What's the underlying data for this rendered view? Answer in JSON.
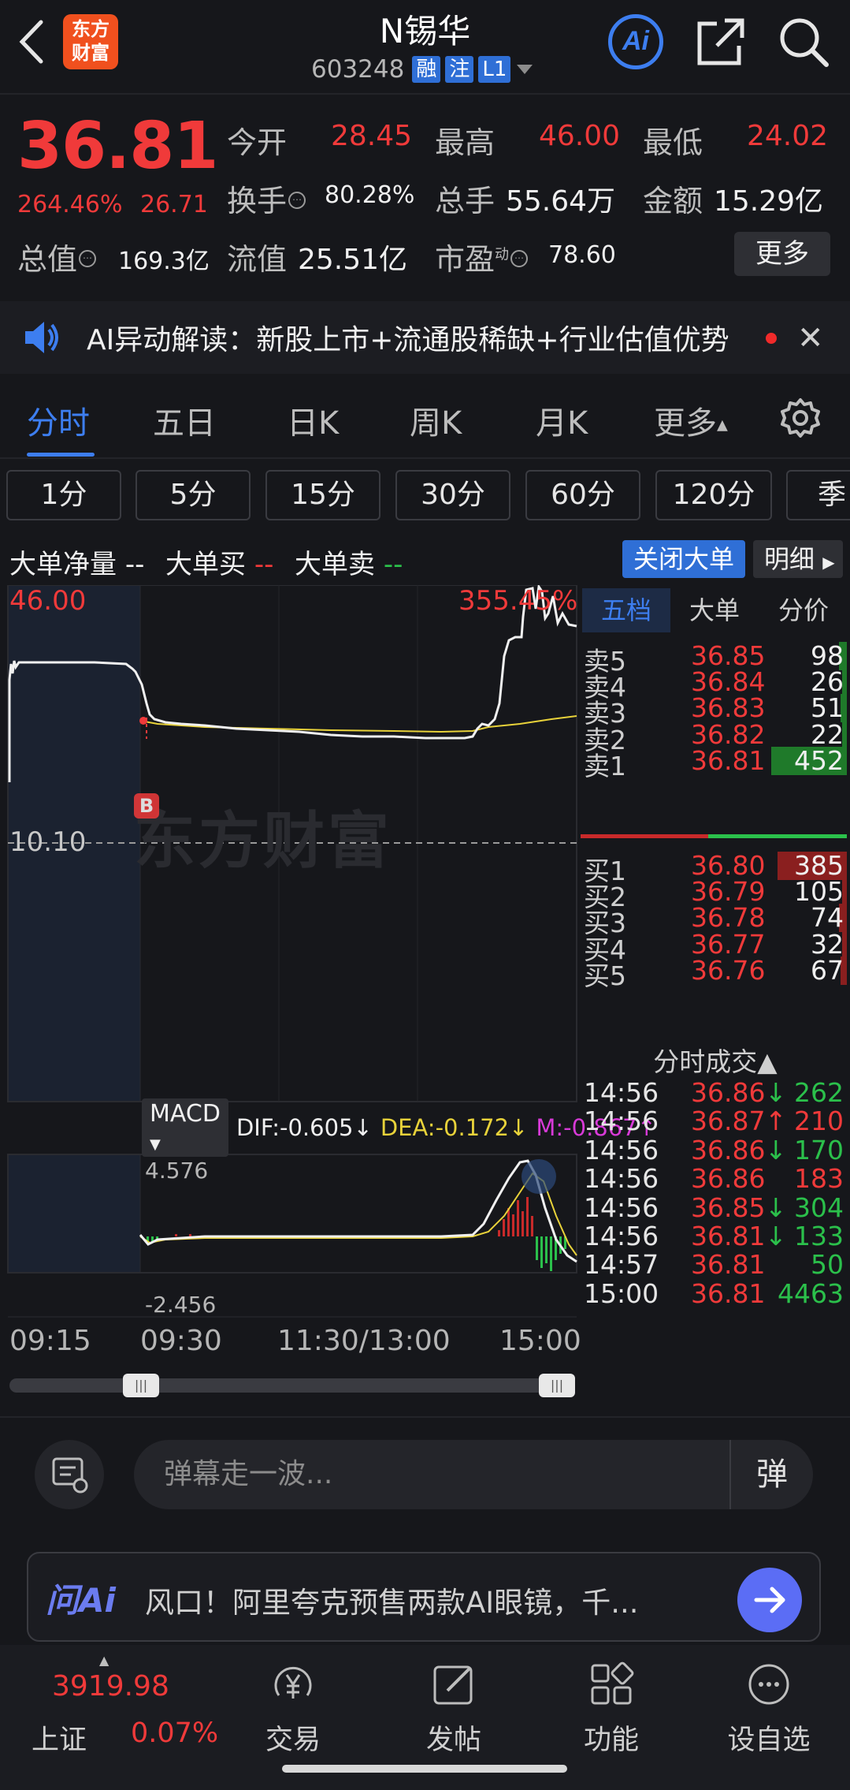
{
  "header": {
    "logo_line1": "东方",
    "logo_line2": "财富",
    "stock_name": "N锡华",
    "stock_code": "603248",
    "tags": [
      "融",
      "注",
      "L1"
    ],
    "ai_label": "Ai",
    "icons": [
      "back-icon",
      "ai-icon",
      "share-icon",
      "search-icon",
      "dropdown-icon"
    ]
  },
  "quote": {
    "price": "36.81",
    "change_pct": "264.46%",
    "change_amt": "26.71",
    "open_label": "今开",
    "open": "28.45",
    "high_label": "最高",
    "high": "46.00",
    "low_label": "最低",
    "low": "24.02",
    "turnover_label": "换手",
    "turnover": "80.28%",
    "volume_label": "总手",
    "volume": "55.64万",
    "amount_label": "金额",
    "amount": "15.29亿",
    "mktcap_label": "总值",
    "mktcap": "169.3亿",
    "float_label": "流值",
    "float_cap": "25.51亿",
    "pe_label": "市盈",
    "pe_sup": "动",
    "pe": "78.60",
    "more_label": "更多",
    "colors": {
      "up": "#f03a3a",
      "down": "#2bc04b",
      "accent": "#3d7ef0"
    }
  },
  "ai_bar": {
    "text": "AI异动解读：新股上市+流通股稀缺+行业估值优势"
  },
  "period_tabs": {
    "items": [
      "分时",
      "五日",
      "日K",
      "周K",
      "月K",
      "更多"
    ],
    "active": "分时"
  },
  "minute_tabs": [
    "1分",
    "5分",
    "15分",
    "30分",
    "60分",
    "120分",
    "季"
  ],
  "big_order": {
    "net_label": "大单净量",
    "net_value": "--",
    "buy_label": "大单买",
    "buy_value": "--",
    "sell_label": "大单卖",
    "sell_value": "--",
    "close_label": "关闭大单",
    "detail_label": "明细"
  },
  "chart": {
    "price_top": "46.00",
    "pct_top": "355.45%",
    "prev_close": "10.10",
    "watermark": "东方财富",
    "b_marker": "B",
    "macd_select": "MACD",
    "dif": "DIF:-0.605↓",
    "dea": "DEA:-0.172↓",
    "m": "M:-0.867↑",
    "macd_high": "4.576",
    "macd_low": "-2.456",
    "time_labels": [
      "09:15",
      "09:30",
      "11:30/13:00",
      "15:00"
    ]
  },
  "orderbook": {
    "tabs": [
      "五档",
      "大单",
      "分价"
    ],
    "active_tab": "五档",
    "asks": [
      {
        "label": "卖5",
        "price": "36.85",
        "vol": "98",
        "bar": 0.06
      },
      {
        "label": "卖4",
        "price": "36.84",
        "vol": "26",
        "bar": 0.04
      },
      {
        "label": "卖3",
        "price": "36.83",
        "vol": "51",
        "bar": 0.05
      },
      {
        "label": "卖2",
        "price": "36.82",
        "vol": "22",
        "bar": 0.04
      },
      {
        "label": "卖1",
        "price": "36.81",
        "vol": "452",
        "bar": 0.6
      }
    ],
    "bids": [
      {
        "label": "买1",
        "price": "36.80",
        "vol": "385",
        "bar": 0.55
      },
      {
        "label": "买2",
        "price": "36.79",
        "vol": "105",
        "bar": 0.04
      },
      {
        "label": "买3",
        "price": "36.78",
        "vol": "74",
        "bar": 0.06
      },
      {
        "label": "买4",
        "price": "36.77",
        "vol": "32",
        "bar": 0.04
      },
      {
        "label": "买5",
        "price": "36.76",
        "vol": "67",
        "bar": 0.05
      }
    ],
    "trades_title": "分时成交▲",
    "trades": [
      {
        "time": "14:56",
        "price": "36.86",
        "arrow": "↓",
        "vol": "262",
        "dir": "down"
      },
      {
        "time": "14:56",
        "price": "36.87",
        "arrow": "↑",
        "vol": "210",
        "dir": "up"
      },
      {
        "time": "14:56",
        "price": "36.86",
        "arrow": "↓",
        "vol": "170",
        "dir": "down"
      },
      {
        "time": "14:56",
        "price": "36.86",
        "arrow": "",
        "vol": "183",
        "dir": "up"
      },
      {
        "time": "14:56",
        "price": "36.85",
        "arrow": "↓",
        "vol": "304",
        "dir": "down"
      },
      {
        "time": "14:56",
        "price": "36.81",
        "arrow": "↓",
        "vol": "133",
        "dir": "down"
      },
      {
        "time": "14:57",
        "price": "36.81",
        "arrow": "",
        "vol": "50",
        "dir": "down"
      },
      {
        "time": "15:00",
        "price": "36.81",
        "arrow": "",
        "vol": "4463",
        "dir": "down"
      }
    ]
  },
  "comment": {
    "placeholder": "弹幕走一波...",
    "danmu_label": "弹"
  },
  "ask_ai": {
    "logo": "问Ai",
    "text": "风口！阿里夸克预售两款AI眼镜，千..."
  },
  "bottom_nav": {
    "index_value": "3919.98",
    "index_name": "上证",
    "index_change": "0.07%",
    "items": [
      {
        "label": "交易",
        "icon": "yuan-icon"
      },
      {
        "label": "发帖",
        "icon": "edit-icon"
      },
      {
        "label": "功能",
        "icon": "grid-icon"
      },
      {
        "label": "设自选",
        "icon": "more-dots-icon"
      }
    ]
  }
}
